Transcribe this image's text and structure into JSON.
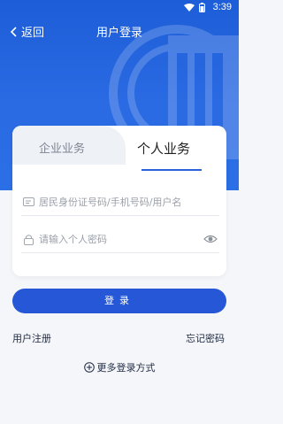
{
  "status": {
    "time": "3:39",
    "battery_icon": "battery-icon",
    "wifi_icon": "wifi-icon"
  },
  "nav": {
    "back_label": "返回",
    "title": "用户登录"
  },
  "tabs": {
    "enterprise": "企业业务",
    "personal": "个人业务"
  },
  "form": {
    "username_placeholder": "居民身份证号码/手机号码/用户名",
    "password_placeholder": "请输入个人密码"
  },
  "actions": {
    "login": "登录",
    "register": "用户注册",
    "forgot": "忘记密码",
    "more": "更多登录方式"
  },
  "colors": {
    "primary": "#2557d6",
    "hero": "#1d5ed8"
  }
}
